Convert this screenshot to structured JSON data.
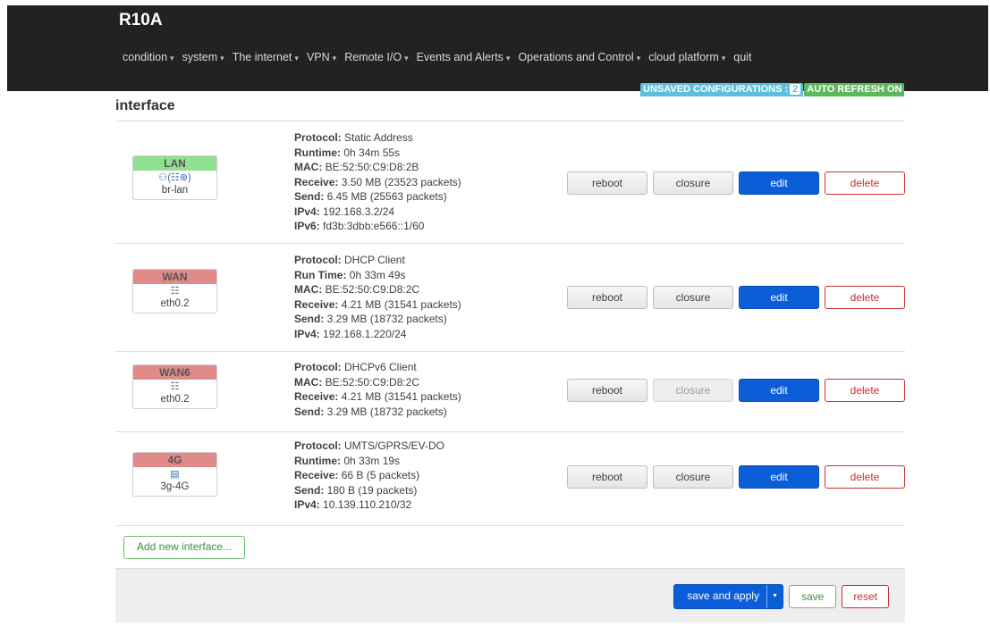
{
  "brand": "R10A",
  "nav": [
    {
      "label": "condition",
      "caret": "▾"
    },
    {
      "label": "system",
      "caret": "▾"
    },
    {
      "label": "The internet",
      "caret": "▾"
    },
    {
      "label": "VPN",
      "caret": "▾"
    },
    {
      "label": "Remote I/O",
      "caret": "▾"
    },
    {
      "label": "Events and Alerts",
      "caret": "▾"
    },
    {
      "label": "Operations and Control",
      "caret": "▾"
    },
    {
      "label": "cloud platform",
      "caret": "▾"
    },
    {
      "label": "quit",
      "caret": ""
    }
  ],
  "badges": {
    "unsaved_label": "UNSAVED CONFIGURATIONS :",
    "unsaved_count": "2",
    "auto_refresh": "AUTO REFRESH ON"
  },
  "page_title": "interface",
  "interfaces": [
    {
      "name": "LAN",
      "status_color": "#90e090",
      "icons": "⚇(☷⊛)",
      "device": "br-lan",
      "details": [
        {
          "key": "Protocol:",
          "value": " Static Address"
        },
        {
          "key": "Runtime:",
          "value": " 0h 34m 55s"
        },
        {
          "key": "MAC:",
          "value": " BE:52:50:C9:D8:2B"
        },
        {
          "key": "Receive:",
          "value": " 3.50 MB (23523 packets)"
        },
        {
          "key": "Send:",
          "value": " 6.45 MB (25563 packets)"
        },
        {
          "key": "IPv4:",
          "value": " 192.168.3.2/24"
        },
        {
          "key": "IPv6:",
          "value": " fd3b:3dbb:e566::1/60"
        }
      ],
      "closure_enabled": true
    },
    {
      "name": "WAN",
      "status_color": "#e08a8a",
      "icons": "☷",
      "device": "eth0.2",
      "details": [
        {
          "key": "Protocol:",
          "value": " DHCP Client"
        },
        {
          "key": "Run Time:",
          "value": " 0h 33m 49s"
        },
        {
          "key": "MAC:",
          "value": " BE:52:50:C9:D8:2C"
        },
        {
          "key": "Receive:",
          "value": " 4.21 MB (31541 packets)"
        },
        {
          "key": "Send:",
          "value": " 3.29 MB (18732 packets)"
        },
        {
          "key": "IPv4:",
          "value": " 192.168.1.220/24"
        }
      ],
      "closure_enabled": true
    },
    {
      "name": "WAN6",
      "status_color": "#e08a8a",
      "icons": "☷",
      "device": "eth0.2",
      "details": [
        {
          "key": "Protocol:",
          "value": " DHCPv6 Client"
        },
        {
          "key": "MAC:",
          "value": " BE:52:50:C9:D8:2C"
        },
        {
          "key": "Receive:",
          "value": " 4.21 MB (31541 packets)"
        },
        {
          "key": "Send:",
          "value": " 3.29 MB (18732 packets)"
        }
      ],
      "closure_enabled": false
    },
    {
      "name": "4G",
      "status_color": "#e08a8a",
      "icons": "▤",
      "device": "3g-4G",
      "details": [
        {
          "key": "Protocol:",
          "value": " UMTS/GPRS/EV-DO"
        },
        {
          "key": "Runtime:",
          "value": " 0h 33m 19s"
        },
        {
          "key": "Receive:",
          "value": " 66 B (5 packets)"
        },
        {
          "key": "Send:",
          "value": " 180 B (19 packets)"
        },
        {
          "key": "IPv4:",
          "value": " 10.139.110.210/32"
        }
      ],
      "closure_enabled": true
    }
  ],
  "row_buttons": {
    "reboot": "reboot",
    "closure": "closure",
    "edit": "edit",
    "delete": "delete"
  },
  "add_interface": "Add new interface...",
  "footer": {
    "save_apply": "save and apply",
    "split_caret": "▾",
    "save": "save",
    "reset": "reset"
  }
}
